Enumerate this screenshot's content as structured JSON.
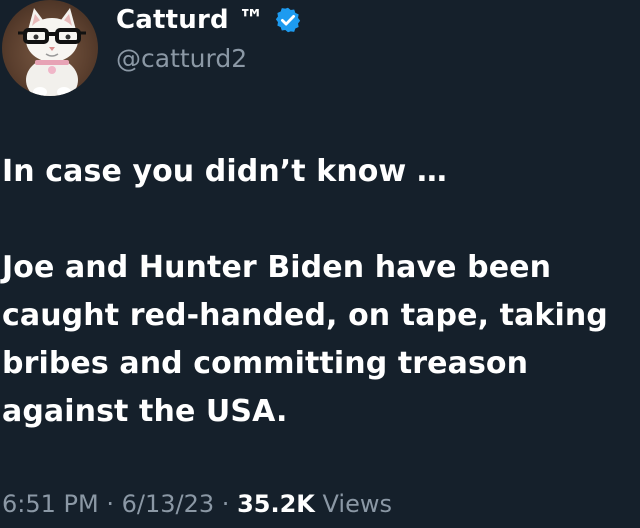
{
  "author": {
    "display_name": "Catturd ™",
    "handle": "@catturd2",
    "avatar_icon": "cat-with-glasses-avatar",
    "verified_icon": "verified-badge-icon",
    "verified_color": "#1d9bf0"
  },
  "tweet": {
    "lines": [
      "In case you didn’t know …",
      "",
      "Joe and Hunter Biden have been",
      "caught red-handed, on tape, taking",
      "bribes and committing treason",
      "against the USA."
    ]
  },
  "meta": {
    "time": "6:51 PM",
    "separator": "·",
    "date": "6/13/23",
    "views_count": "35.2K",
    "views_label": "Views"
  },
  "colors": {
    "background": "#15202b",
    "text": "#ffffff",
    "secondary_text": "#8b98a5"
  }
}
